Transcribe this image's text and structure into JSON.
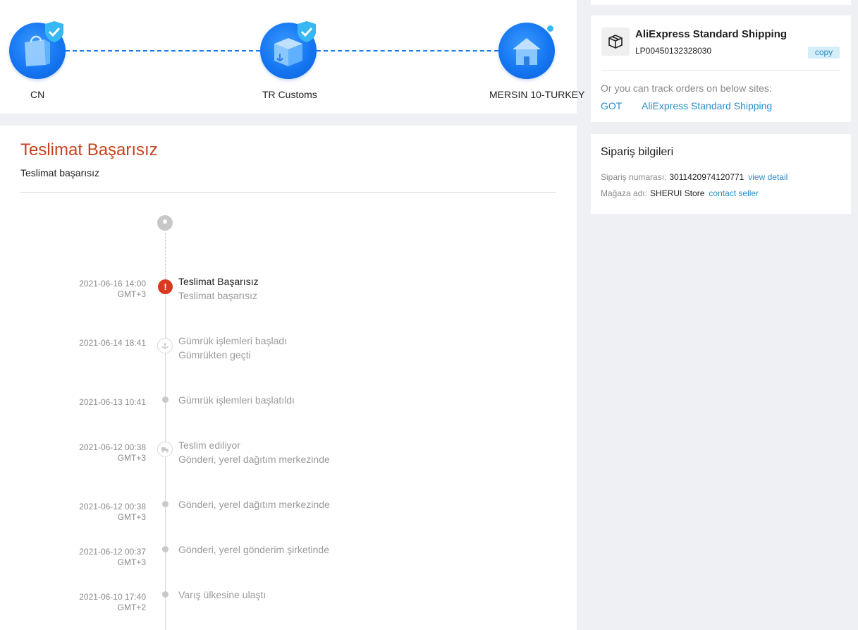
{
  "progress": {
    "stages": [
      {
        "label": "CN",
        "icon": "shopping-bag-icon",
        "completed": true
      },
      {
        "label": "TR Customs",
        "icon": "customs-box-icon",
        "completed": true
      },
      {
        "label": "MERSIN 10-TURKEY",
        "icon": "house-icon",
        "completed": false
      }
    ]
  },
  "status": {
    "title": "Teslimat Başarısız",
    "subtitle": "Teslimat başarısız"
  },
  "timeline": [
    {
      "date": "2021-06-16 14:00",
      "tz": "GMT+3",
      "title": "Teslimat Başarısız",
      "detail": "Teslimat başarısız",
      "icon": "alert-icon"
    },
    {
      "date": "2021-06-14 18:41",
      "tz": "",
      "title": "Gümrük işlemleri başladı",
      "detail": "Gümrükten geçti",
      "icon": "anchor-icon"
    },
    {
      "date": "2021-06-13 10:41",
      "tz": "",
      "title": "Gümrük işlemleri başlatıldı",
      "detail": "",
      "icon": "dot"
    },
    {
      "date": "2021-06-12 00:38",
      "tz": "GMT+3",
      "title": "Teslim ediliyor",
      "detail": "Gönderi, yerel dağıtım merkezinde",
      "icon": "truck-icon"
    },
    {
      "date": "2021-06-12 00:38",
      "tz": "GMT+3",
      "title": "Gönderi, yerel dağıtım merkezinde",
      "detail": "",
      "icon": "dot"
    },
    {
      "date": "2021-06-12 00:37",
      "tz": "GMT+3",
      "title": "Gönderi, yerel gönderim şirketinde",
      "detail": "",
      "icon": "dot"
    },
    {
      "date": "2021-06-10 17:40",
      "tz": "GMT+2",
      "title": "Varış ülkesine ulaştı",
      "detail": "",
      "icon": "dot"
    }
  ],
  "shipping": {
    "carrier": "AliExpress Standard Shipping",
    "tracking_number": "LP00450132328030",
    "copy_label": "copy",
    "track_hint": "Or you can track orders on below sites:",
    "sites": [
      "GOT",
      "AliExpress Standard Shipping"
    ]
  },
  "order": {
    "title": "Sipariş bilgileri",
    "number_label": "Sipariş numarası:",
    "number_value": "3011420974120771",
    "view_detail": "view detail",
    "store_label": "Mağaza adı:",
    "store_value": "SHERUI Store",
    "contact_seller": "contact seller"
  },
  "colors": {
    "accent_blue": "#1576f2",
    "link_blue": "#2b8ec9",
    "failure_red": "#c9401e",
    "alert_red": "#d9391c"
  }
}
